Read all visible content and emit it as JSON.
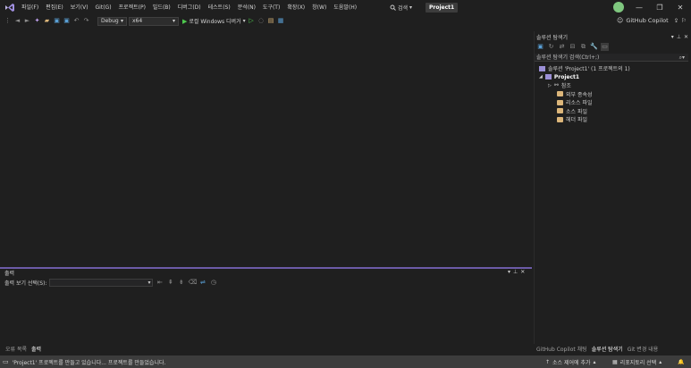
{
  "menu": [
    "파일(F)",
    "편집(E)",
    "보기(V)",
    "Git(G)",
    "프로젝트(P)",
    "빌드(B)",
    "디버그(D)",
    "테스트(S)",
    "분석(N)",
    "도구(T)",
    "확장(X)",
    "창(W)",
    "도움말(H)"
  ],
  "search_label": "검색",
  "project_name": "Project1",
  "window": {
    "minimize": "—",
    "maximize": "❐",
    "close": "✕"
  },
  "toolbar": {
    "config": "Debug",
    "platform": "x64",
    "run_label": "로컬 Windows 디버거"
  },
  "copilot_label": "GitHub Copilot",
  "solution_explorer": {
    "title": "솔루션 탐색기",
    "search_placeholder": "솔루션 탐색기 검색(Ctrl+;)",
    "solution_label": "솔루션 'Project1' (1 프로젝트의 1)",
    "project": "Project1",
    "items": [
      "참조",
      "외부 종속성",
      "리소스 파일",
      "소스 파일",
      "헤더 파일"
    ]
  },
  "output": {
    "title": "출력",
    "show_from_label": "출력 보기 선택(S):"
  },
  "bottom_tabs_left": [
    "오류 목록",
    "출력"
  ],
  "bottom_tabs_right": [
    "GitHub Copilot 채팅",
    "솔루션 탐색기",
    "Git 변경 내용"
  ],
  "status": {
    "message": "'Project1' 프로젝트를 만들고 있습니다... 프로젝트를 만들었습니다.",
    "source_control": "소스 제어에 추가",
    "repo": "리포지토리 선택"
  },
  "colors": {
    "accent": "#6c5ba7",
    "status_bg": "#3c3c3c",
    "run_green": "#4ec94e",
    "folder": "#dcb67a"
  }
}
